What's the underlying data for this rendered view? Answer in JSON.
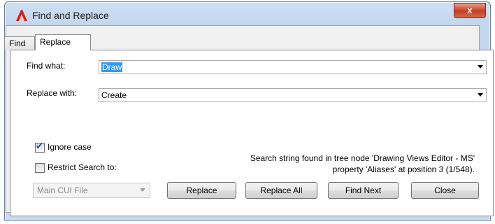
{
  "window": {
    "title": "Find and Replace",
    "close_glyph": "x"
  },
  "tabs": [
    {
      "label": "Find"
    },
    {
      "label": "Replace"
    }
  ],
  "find": {
    "label": "Find what:",
    "value": "Draw"
  },
  "replace": {
    "label": "Replace with:",
    "value": "Create"
  },
  "options": {
    "ignore_case": {
      "label": "Ignore case",
      "checked": true
    },
    "restrict": {
      "label": "Restrict Search to:",
      "checked": false
    },
    "restrict_target": {
      "value": "Main CUI File"
    }
  },
  "status": {
    "line1": "Search string found in tree node 'Drawing Views Editor - MS'",
    "line2": "property 'Aliases' at position 3 (1/548)."
  },
  "buttons": {
    "replace": "Replace",
    "replace_all": "Replace All",
    "find_next": "Find Next",
    "close": "Close"
  },
  "icons": {
    "app": "autocad-icon",
    "close": "close-icon"
  }
}
